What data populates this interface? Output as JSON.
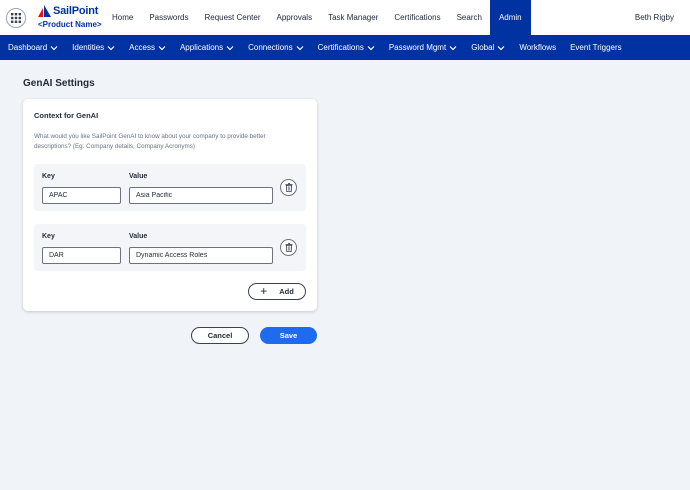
{
  "header": {
    "logo_text": "SailPoint",
    "product_name": "<Product Name>",
    "nav": [
      {
        "label": "Home"
      },
      {
        "label": "Passwords"
      },
      {
        "label": "Request Center"
      },
      {
        "label": "Approvals"
      },
      {
        "label": "Task Manager"
      },
      {
        "label": "Certifications"
      },
      {
        "label": "Search"
      },
      {
        "label": "Admin",
        "active": true
      }
    ],
    "user_name": "Beth Rigby"
  },
  "subnav": [
    {
      "label": "Dashboard",
      "has_dropdown": true
    },
    {
      "label": "Identities",
      "has_dropdown": true
    },
    {
      "label": "Access",
      "has_dropdown": true
    },
    {
      "label": "Applications",
      "has_dropdown": true
    },
    {
      "label": "Connections",
      "has_dropdown": true
    },
    {
      "label": "Certifications",
      "has_dropdown": true
    },
    {
      "label": "Password Mgmt",
      "has_dropdown": true
    },
    {
      "label": "Global",
      "has_dropdown": true
    },
    {
      "label": "Workflows",
      "has_dropdown": false
    },
    {
      "label": "Event Triggers",
      "has_dropdown": false
    }
  ],
  "page": {
    "title": "GenAI Settings",
    "card": {
      "title": "Context for GenAI",
      "description": "What would you like SailPoint GenAI to know about your company to provide better descriptions? (Eg. Company details, Company Acronyms)",
      "key_label": "Key",
      "value_label": "Value",
      "rows": [
        {
          "key": "APAC",
          "value": "Asia Pacific"
        },
        {
          "key": "DAR",
          "value": "Dynamic Access Roles"
        }
      ],
      "add_label": "Add"
    },
    "cancel_label": "Cancel",
    "save_label": "Save"
  },
  "colors": {
    "brand_blue": "#0033a1",
    "primary_button": "#1e6bf0",
    "page_bg": "#f0f3f7"
  },
  "icons": {
    "app_launcher": "grid-icon",
    "delete": "trash-icon",
    "add": "plus-icon",
    "dropdown": "chevron-down-icon"
  }
}
